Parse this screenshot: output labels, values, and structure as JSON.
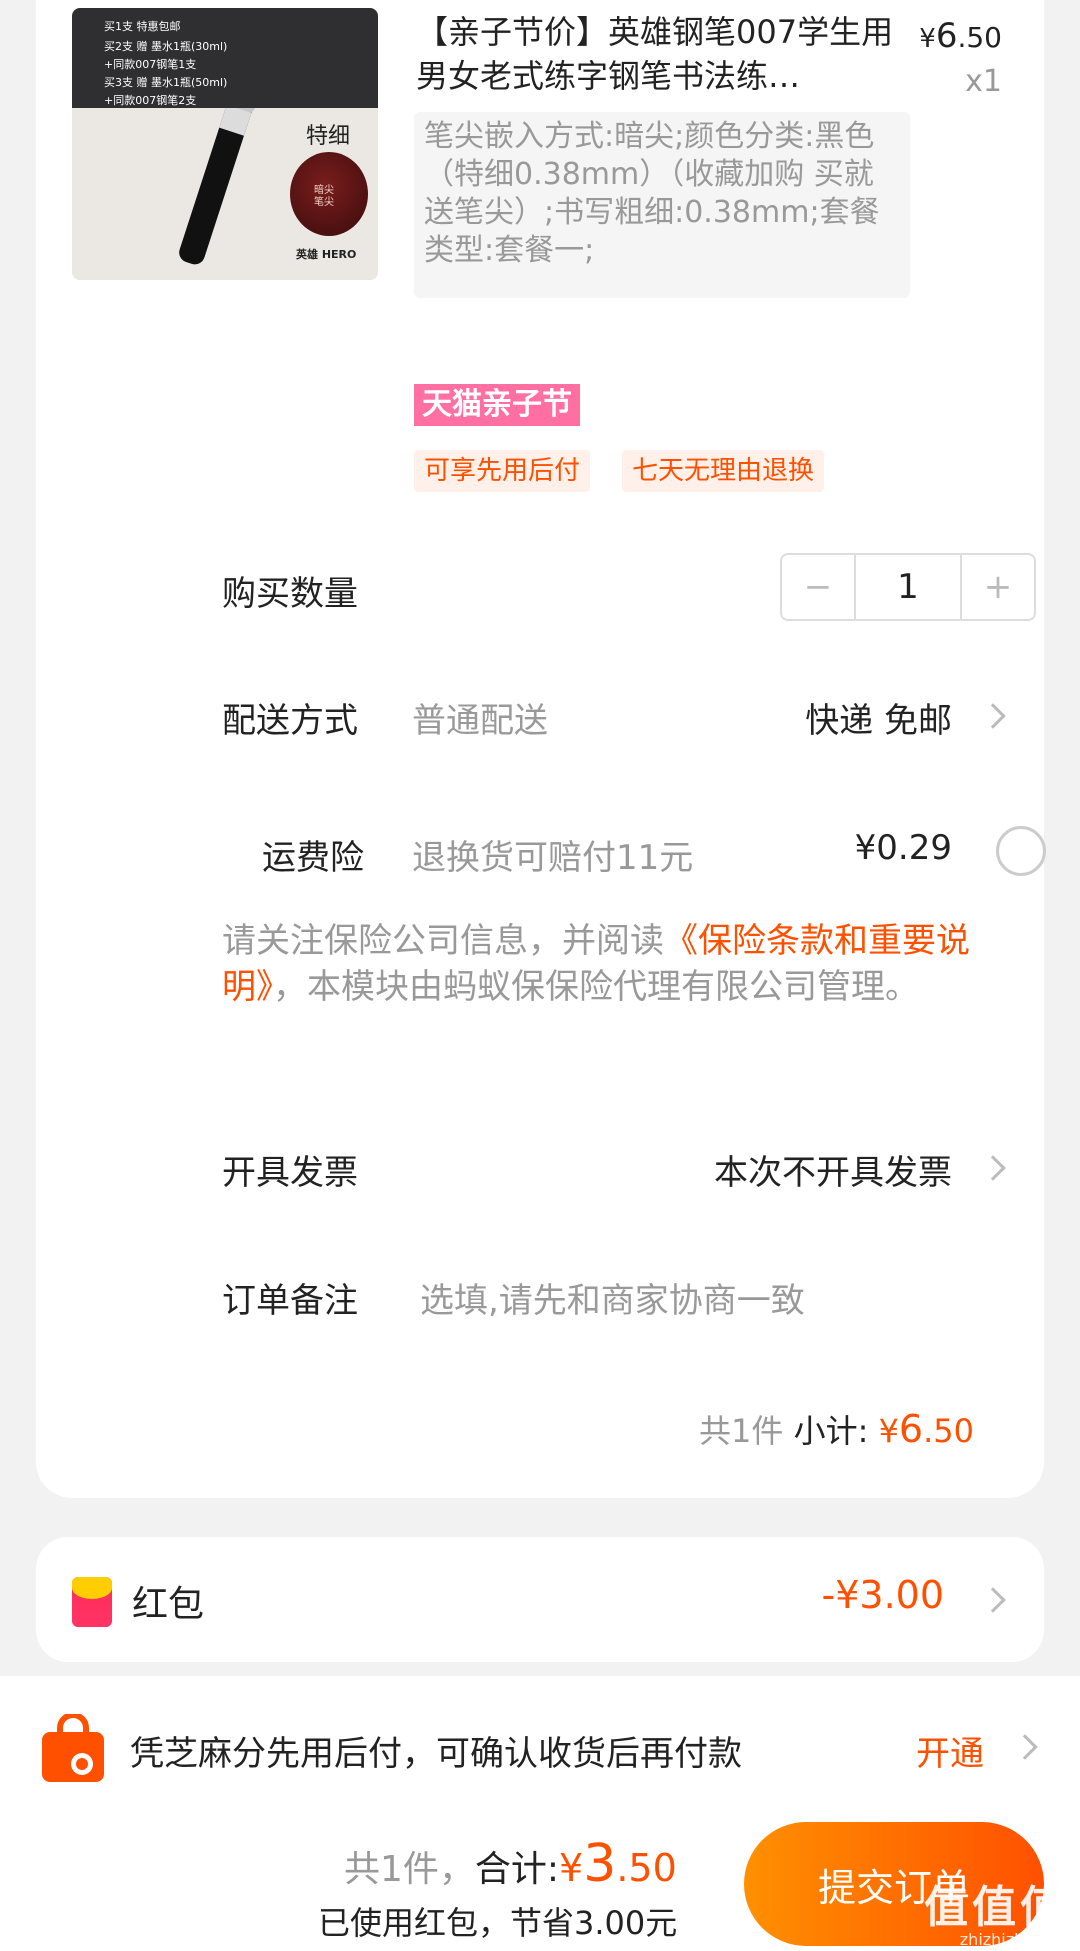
{
  "product": {
    "image_promo_lines": [
      "买1支 特惠包邮",
      "买2支 赠 墨水1瓶(30ml)",
      "+同款007钢笔1支",
      "买3支 赠 墨水1瓶(50ml)",
      "+同款007钢笔2支"
    ],
    "image_tag": "特细",
    "image_nib_text": "暗尖笔尖",
    "image_brand": "英雄 HERO",
    "title": "【亲子节价】英雄钢笔007学生用男女老式练字钢笔书法练…",
    "price_yen": "¥",
    "price_int": "6",
    "price_dec": ".50",
    "quantity_label": "x1",
    "spec": "笔尖嵌入方式:暗尖;颜色分类:黑色（特细0.38mm）（收藏加购 买就送笔尖）;书写粗细:0.38mm;套餐类型:套餐一;",
    "event_tag": "天猫亲子节",
    "service_tags": [
      "可享先用后付",
      "七天无理由退换"
    ]
  },
  "quantity_row": {
    "label": "购买数量",
    "minus": "−",
    "value": "1",
    "plus": "+"
  },
  "delivery_row": {
    "label": "配送方式",
    "sub": "普通配送",
    "value": "快递 免邮"
  },
  "insurance_row": {
    "label": "运费险",
    "sub": "退换货可赔付11元",
    "value": "¥0.29",
    "checked": false
  },
  "notice": {
    "prefix": "请关注保险公司信息，并阅读",
    "link": "《保险条款和重要说明》",
    "suffix": "，本模块由蚂蚁保保险代理有限公司管理。"
  },
  "invoice_row": {
    "label": "开具发票",
    "value": "本次不开具发票"
  },
  "remark_row": {
    "label": "订单备注",
    "placeholder": "选填,请先和商家协商一致"
  },
  "subtotal": {
    "count": "共1件",
    "label": "小计:",
    "yen": "¥",
    "int": "6",
    "dec": ".50"
  },
  "red_packet": {
    "label": "红包",
    "value": "-¥3.00"
  },
  "credit_pay": {
    "text": "凭芝麻分先用后付，可确认收货后再付款",
    "action": "开通"
  },
  "footer": {
    "count": "共1件，",
    "total_label": "合计:",
    "yen": "¥",
    "int": "3",
    "dec": ".50",
    "saving": "已使用红包，节省3.00元",
    "submit": "提交订单"
  },
  "watermark": {
    "big": "值值值",
    "small": "zhizhizhi.com"
  },
  "colors": {
    "accent": "#ff5000",
    "accent_gradient_start": "#ff9000",
    "tmall_pink": "#ff6fa1",
    "muted_text": "#999999",
    "page_bg": "#f2f2f2"
  }
}
